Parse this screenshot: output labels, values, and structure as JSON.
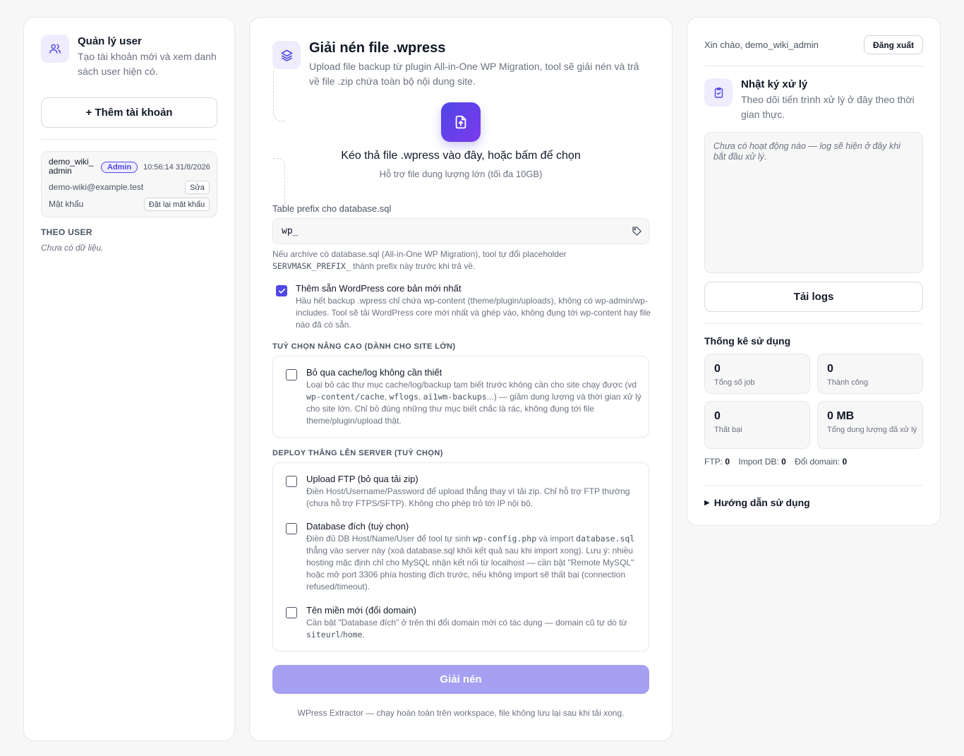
{
  "left": {
    "title": "Quản lý user",
    "desc": "Tạo tài khoản mới và xem danh sách user hiện có.",
    "add_button": "+ Thêm tài khoản",
    "user": {
      "name": "demo_wiki_ admin",
      "role": "Admin",
      "time": "10:56:14 31/8/2026",
      "email": "demo-wiki@example.test",
      "edit": "Sửa",
      "password_label": "Mật khẩu",
      "reset": "Đặt lại mật khẩu"
    },
    "by_user_heading": "THEO USER",
    "empty": "Chưa có dữ liệu."
  },
  "main": {
    "title": "Giải nén file .wpress",
    "desc": "Upload file backup từ plugin All-in-One WP Migration, tool sẽ giải nén và trả về file .zip chứa toàn bộ nội dung site.",
    "drop_title": "Kéo thả file .wpress vào đây, hoặc bấm để chọn",
    "drop_sub": "Hỗ trợ file dung lượng lớn (tối đa 10GB)",
    "prefix_label": "Table prefix cho database.sql",
    "prefix_value": "wp_",
    "prefix_note_1": "Nếu archive có database.sql (All-in-One WP Migration), tool tự đổi placeholder",
    "prefix_note_code": "SERVMASK_PREFIX_",
    "prefix_note_2": " thành prefix này trước khi trả về.",
    "core_title": "Thêm sẵn WordPress core bản mới nhất",
    "core_desc": "Hầu hết backup .wpress chỉ chứa wp-content (theme/plugin/uploads), không có wp-admin/wp-includes. Tool sẽ tải WordPress core mới nhất và ghép vào, không đụng tới wp-content hay file nào đã có sẵn.",
    "advanced_heading": "TUỲ CHỌN NÂNG CAO (DÀNH CHO SITE LỚN)",
    "skip_title": "Bỏ qua cache/log không cần thiết",
    "skip_desc_1": "Loại bỏ các thư mục cache/log/backup tạm biết trước không cần cho site chạy được (vd ",
    "skip_code_1": "wp-content/cache",
    "skip_sep_1": ", ",
    "skip_code_2": "wflogs",
    "skip_sep_2": ", ",
    "skip_code_3": "ai1wm-backups",
    "skip_desc_2": "...) — giảm dung lượng và thời gian xử lý cho site lớn. Chỉ bỏ đúng những thư mục biết chắc là rác, không đụng tới file theme/plugin/upload thật.",
    "deploy_heading": "DEPLOY THẲNG LÊN SERVER (TUỲ CHỌN)",
    "ftp_title": "Upload FTP (bỏ qua tải zip)",
    "ftp_desc": "Điền Host/Username/Password để upload thẳng thay vì tải zip. Chỉ hỗ trợ FTP thường (chưa hỗ trợ FTPS/SFTP). Không cho phép trỏ tới IP nội bộ.",
    "db_title": "Database đích (tuỳ chọn)",
    "db_desc_1": "Điền đủ DB Host/Name/User để tool tự sinh ",
    "db_code_1": "wp-config.php",
    "db_desc_2": " và import ",
    "db_code_2": "database.sql",
    "db_desc_3": " thẳng vào server này (xoá database.sql khỏi kết quả sau khi import xong). Lưu ý: nhiều hosting mặc định chỉ cho MySQL nhận kết nối từ localhost — cần bật \"Remote MySQL\" hoặc mở port 3306 phía hosting đích trước, nếu không import sẽ thất bại (connection refused/timeout).",
    "domain_title": "Tên miền mới (đổi domain)",
    "domain_desc_1": "Cần bật \"Database đích\" ở trên thì đổi domain mới có tác dụng — domain cũ tự dò từ ",
    "domain_code": "siteurl",
    "domain_desc_2": "/",
    "domain_code_2": "home",
    "domain_desc_3": ".",
    "extract_button": "Giải nén",
    "footer": "WPress Extractor — chạy hoàn toàn trên workspace, file không lưu lại sau khi tải xong."
  },
  "right": {
    "greeting": "Xin chào, demo_wiki_admin",
    "logout": "Đăng xuất",
    "log_title": "Nhật ký xử lý",
    "log_desc": "Theo dõi tiến trình xử lý ở đây theo thời gian thực.",
    "log_empty": "Chưa có hoạt động nào — log sẽ hiện ở đây khi bắt đầu xử lý.",
    "download_logs": "Tải logs",
    "stats_title": "Thống kê sử dụng",
    "stats": [
      {
        "value": "0",
        "label": "Tổng số job"
      },
      {
        "value": "0",
        "label": "Thành công"
      },
      {
        "value": "0",
        "label": "Thất bại"
      },
      {
        "value": "0 MB",
        "label": "Tổng dung lượng đã xử lý"
      }
    ],
    "ftp_label": "FTP:",
    "ftp_value": "0",
    "import_label": "Import DB:",
    "import_value": "0",
    "domain_label": "Đổi domain:",
    "domain_value": "0",
    "guide": "Hướng dẫn sử dụng"
  },
  "colors": {
    "accent": "#5047e5",
    "accent_light": "#eeecfd",
    "button_disabled": "#a5a0f2"
  },
  "icons": [
    "users-icon",
    "layers-icon",
    "file-upload-icon",
    "tag-icon",
    "clipboard-check-icon",
    "check-icon",
    "triangle-right-icon"
  ]
}
